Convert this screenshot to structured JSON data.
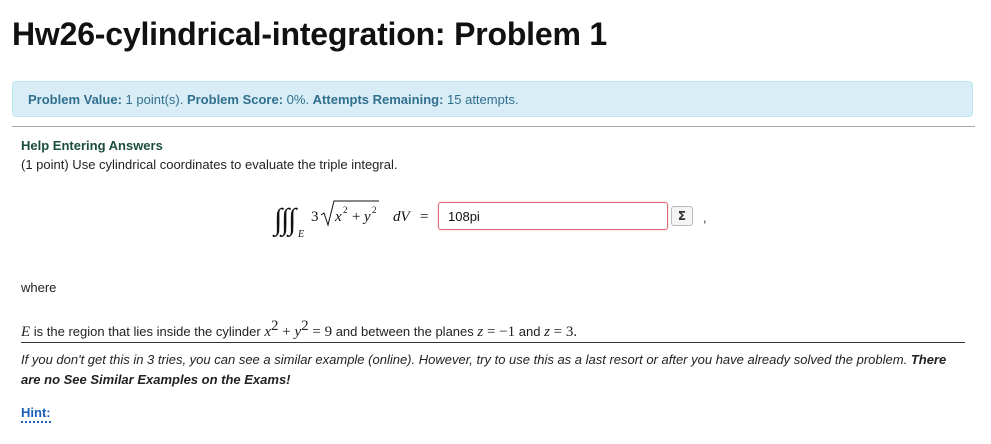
{
  "page": {
    "title": "Hw26-cylindrical-integration: Problem 1"
  },
  "status": {
    "value_label": "Problem Value:",
    "value_text": " 1 point(s). ",
    "score_label": "Problem Score:",
    "score_text": " 0%. ",
    "attempts_label": "Attempts Remaining:",
    "attempts_text": " 15 attempts."
  },
  "help": {
    "link_label": "Help Entering Answers"
  },
  "problem": {
    "intro": "(1 point) Use cylindrical coordinates to evaluate the triple integral.",
    "equation": {
      "region_sub": "E",
      "coef": "3",
      "x_term": "x",
      "plus": "+",
      "y_term": "y",
      "power": "2",
      "dv": "dV",
      "equals": "="
    },
    "answer_value": "108pi",
    "equation_editor_label": "Σ",
    "trailing_comma": ",",
    "where_label": "where",
    "region_text": {
      "E": "E",
      "part1": " is the region that lies inside the cylinder ",
      "x": "x",
      "exp": "2",
      "plus": " + ",
      "y": "y",
      "eq9": " = 9",
      "part2": " and between the planes ",
      "z": "z",
      "eq_neg1": " = −1",
      "part3": " and ",
      "eq3": " = 3."
    }
  },
  "note": {
    "text": "If you don't get this in 3 tries, you can see a similar example (online). However, try to use this as a last resort or after you have already solved the problem. ",
    "bold_text": "There are no See Similar Examples on the Exams!"
  },
  "hint": {
    "label": "Hint:"
  },
  "colors": {
    "alert_bg": "#d9edf7",
    "alert_text": "#31708f",
    "input_border": "#e06c75",
    "hint_link": "#1c5fb8"
  }
}
